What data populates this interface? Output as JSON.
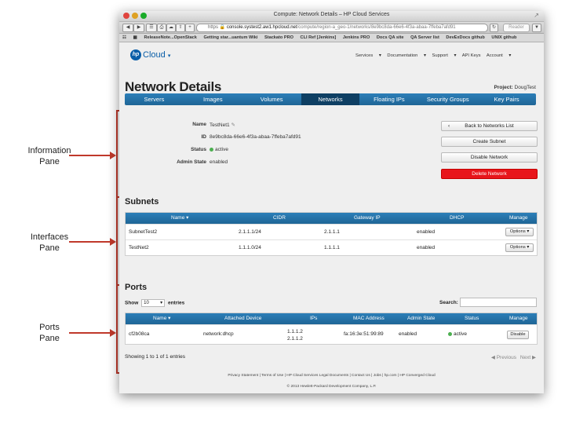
{
  "annotations": {
    "information_pane": [
      "Information",
      "Pane"
    ],
    "interfaces_pane": [
      "Interfaces",
      "Pane"
    ],
    "ports_pane": [
      "Ports",
      "Pane"
    ]
  },
  "browser": {
    "title": "Compute: Network Details – HP Cloud Services",
    "url_scheme": "https",
    "url_host": "console.systest2.aw1.hpcloud.net",
    "url_path": "/compute/region-a_geo-1/networks/8e9bc8da-66e6-4f3a-abaa-7ffeba7afd91",
    "reader_label": "Reader",
    "bookmarks": [
      "ReleaseNote...OpenStack",
      "Getting star...uantum Wiki",
      "Stackato PRO",
      "CLI Ref [Jenkins]",
      "Jenkins PRO",
      "Docs QA site",
      "QA Server list",
      "DevExDocs github",
      "UNIX github"
    ]
  },
  "header": {
    "logo_mark": "hp",
    "logo_text": "Cloud",
    "nav": [
      "Services",
      "Documentation",
      "Support",
      "API Keys",
      "Account"
    ],
    "page_title": "Network Details",
    "project_label": "Project:",
    "project_value": "DougTest"
  },
  "tabs": [
    "Servers",
    "Images",
    "Volumes",
    "Networks",
    "Floating IPs",
    "Security Groups",
    "Key Pairs"
  ],
  "active_tab": "Networks",
  "info": {
    "name_label": "Name",
    "name_value": "TestNet1",
    "id_label": "ID",
    "id_value": "8e9bc8da-66e6-4f3a-abaa-7ffeba7afd91",
    "status_label": "Status",
    "status_value": "active",
    "admin_state_label": "Admin State",
    "admin_state_value": "enabled"
  },
  "actions": {
    "back": "Back to Networks List",
    "create_subnet": "Create Subnet",
    "disable_network": "Disable Network",
    "delete_network": "Delete Network"
  },
  "subnets": {
    "heading": "Subnets",
    "columns": [
      "Name",
      "CIDR",
      "Gateway IP",
      "DHCP",
      "Manage"
    ],
    "rows": [
      {
        "name": "SubnetTest2",
        "cidr": "2.1.1.1/24",
        "gateway": "2.1.1.1",
        "dhcp": "enabled",
        "manage": "Options"
      },
      {
        "name": "TestNet2",
        "cidr": "1.1.1.0/24",
        "gateway": "1.1.1.1",
        "dhcp": "enabled",
        "manage": "Options"
      }
    ]
  },
  "ports": {
    "heading": "Ports",
    "show_label": "Show",
    "show_value": "10",
    "entries_label": "entries",
    "search_label": "Search:",
    "columns": [
      "Name",
      "Attached Device",
      "IPs",
      "MAC Address",
      "Admin State",
      "Status",
      "Manage"
    ],
    "rows": [
      {
        "name": "cf2b08ca",
        "device": "network:dhcp",
        "ip1": "1.1.1.2",
        "ip2": "2.1.1.2",
        "mac": "fa:16:3e:51:99:89",
        "admin_state": "enabled",
        "status": "active",
        "manage": "Disable"
      }
    ],
    "summary": "Showing 1 to 1 of 1 entries",
    "previous": "Previous",
    "next": "Next"
  },
  "footer": {
    "links": [
      "Privacy Statement",
      "Terms of Use",
      "HP Cloud Services Legal Documents",
      "Contact Us",
      "Jobs",
      "hp.com",
      "HP Converged Cloud"
    ],
    "copyright": "© 2013 Hewlett-Packard Development Company, L.P."
  },
  "colors": {
    "accent_blue": "#1f6596",
    "danger_red": "#e8151b",
    "annotation_red": "#c0392b",
    "status_green": "#4caf50"
  }
}
